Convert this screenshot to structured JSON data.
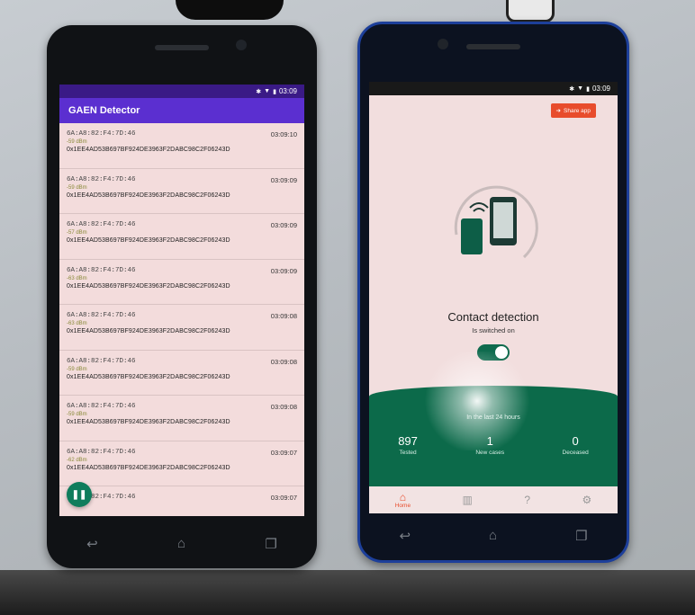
{
  "left_phone": {
    "status_time": "03:09",
    "app_title": "GAEN Detector",
    "devices": [
      {
        "mac": "6A:A8:82:F4:7D:46",
        "rssi": "-59 dBm",
        "key": "0x1EE4AD53B697BF924DE3963F2DABC98C2F06243D",
        "time": "03:09:10"
      },
      {
        "mac": "6A:A8:82:F4:7D:46",
        "rssi": "-59 dBm",
        "key": "0x1EE4AD53B697BF924DE3963F2DABC98C2F06243D",
        "time": "03:09:09"
      },
      {
        "mac": "6A:A8:82:F4:7D:46",
        "rssi": "-57 dBm",
        "key": "0x1EE4AD53B697BF924DE3963F2DABC98C2F06243D",
        "time": "03:09:09"
      },
      {
        "mac": "6A:A8:82:F4:7D:46",
        "rssi": "-63 dBm",
        "key": "0x1EE4AD53B697BF924DE3963F2DABC98C2F06243D",
        "time": "03:09:09"
      },
      {
        "mac": "6A:A8:82:F4:7D:46",
        "rssi": "-63 dBm",
        "key": "0x1EE4AD53B697BF924DE3963F2DABC98C2F06243D",
        "time": "03:09:08"
      },
      {
        "mac": "6A:A8:82:F4:7D:46",
        "rssi": "-59 dBm",
        "key": "0x1EE4AD53B697BF924DE3963F2DABC98C2F06243D",
        "time": "03:09:08"
      },
      {
        "mac": "6A:A8:82:F4:7D:46",
        "rssi": "-59 dBm",
        "key": "0x1EE4AD53B697BF924DE3963F2DABC98C2F06243D",
        "time": "03:09:08"
      },
      {
        "mac": "6A:A8:82:F4:7D:46",
        "rssi": "-62 dBm",
        "key": "0x1EE4AD53B697BF924DE3963F2DABC98C2F06243D",
        "time": "03:09:07"
      },
      {
        "mac": "6A:A8:82:F4:7D:46",
        "rssi": "",
        "key": "",
        "time": "03:09:07"
      }
    ],
    "fab_icon": "pause-icon"
  },
  "right_phone": {
    "status_time": "03:09",
    "share_label": "Share app",
    "contact_title": "Contact detection",
    "contact_subtitle": "Is switched on",
    "toggle_on": true,
    "period_label": "In the last 24 hours",
    "stats": [
      {
        "value": "897",
        "label": "Tested"
      },
      {
        "value": "1",
        "label": "New cases"
      },
      {
        "value": "0",
        "label": "Deceased"
      }
    ],
    "nav": [
      {
        "icon": "home-icon",
        "label": "Home",
        "active": true
      },
      {
        "icon": "chart-icon",
        "label": "",
        "active": false
      },
      {
        "icon": "help-icon",
        "label": "",
        "active": false
      },
      {
        "icon": "gear-icon",
        "label": "",
        "active": false
      }
    ]
  },
  "colors": {
    "appbar": "#5b2fd0",
    "accent": "#e84c2c",
    "green": "#0c6a4a"
  }
}
